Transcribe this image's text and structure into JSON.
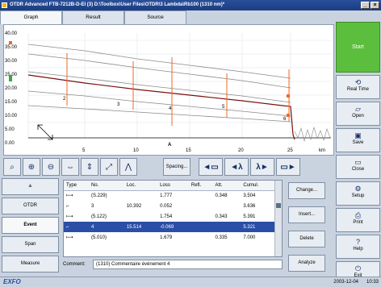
{
  "window": {
    "title": "OTDR Advanced FTB-7212B-D-EI (3) D:\\Toolbox\\User Files\\OTDR\\3 Lambda\\Rb100 (1310 nm)*",
    "minimize": "_",
    "close": "×"
  },
  "tabs": [
    {
      "label": "Graph",
      "active": true
    },
    {
      "label": "Result",
      "active": false
    },
    {
      "label": "Source",
      "active": false
    }
  ],
  "graph": {
    "y_ticks": [
      "40.00",
      "35.00",
      "30.00",
      "25.00",
      "20.00",
      "15.00",
      "10.00",
      "5.00",
      "0.00"
    ],
    "x_ticks": [
      "5",
      "10",
      "15",
      "20",
      "25"
    ],
    "x_unit": "km",
    "event_markers": [
      "1",
      "2",
      "3",
      "4",
      "5",
      "6"
    ],
    "cursor_label": "A",
    "zoom_icon": "expand-arrows-icon"
  },
  "toolbar": {
    "spacing_label": "Spacing...",
    "lambda_prev": "◄λ",
    "lambda_next": "λ►"
  },
  "leftnav": {
    "up_arrow": "▲",
    "items": [
      {
        "label": "OTDR",
        "active": false
      },
      {
        "label": "Event",
        "active": true
      },
      {
        "label": "Span",
        "active": false
      },
      {
        "label": "Measure",
        "active": false
      }
    ],
    "down_arrow": "▼"
  },
  "events_table": {
    "headers": [
      "Type",
      "No.",
      "Loc.",
      "Loss",
      "Refl.",
      "Att.",
      "Cumul."
    ],
    "rows": [
      {
        "type": "⟼",
        "no": "(S.229)",
        "loc": "",
        "loss": "1.777",
        "refl": "",
        "att": "0.348",
        "cumul": "3.504",
        "selected": false
      },
      {
        "type": "⌐",
        "no": "3",
        "loc": "10.392",
        "loss": "0.052",
        "refl": "",
        "att": "",
        "cumul": "3.636",
        "selected": false
      },
      {
        "type": "⟼",
        "no": "(5.122)",
        "loc": "",
        "loss": "1.754",
        "refl": "",
        "att": "0.343",
        "cumul": "5.391",
        "selected": false
      },
      {
        "type": "⌐",
        "no": "4",
        "loc": "15.514",
        "loss": "-0.069",
        "refl": "",
        "att": "",
        "cumul": "5.321",
        "selected": true
      },
      {
        "type": "⟼",
        "no": "(5.010)",
        "loc": "",
        "loss": "1.679",
        "refl": "",
        "att": "0.335",
        "cumul": "7.000",
        "selected": false
      }
    ]
  },
  "comment": {
    "label": "Comment:",
    "value": "(1310) Commentaire évènement 4"
  },
  "actions": {
    "change": "Change...",
    "insert": "Insert...",
    "delete": "Delete",
    "analyze": "Analyze"
  },
  "rightpanel": {
    "start": "Start",
    "buttons": [
      {
        "label": "Real Time",
        "icon": "refresh-icon"
      },
      {
        "label": "Open",
        "icon": "open-folder-icon"
      },
      {
        "label": "Save",
        "icon": "save-disk-icon"
      },
      {
        "label": "Close",
        "icon": "folder-close-icon"
      },
      {
        "label": "Setup",
        "icon": "setup-icon"
      },
      {
        "label": "Print",
        "icon": "printer-icon"
      },
      {
        "label": "Help",
        "icon": "help-icon"
      },
      {
        "label": "Exit",
        "icon": "power-icon"
      }
    ]
  },
  "status": {
    "brand": "EXFO",
    "date": "2003-12-04",
    "time": "10:33"
  }
}
